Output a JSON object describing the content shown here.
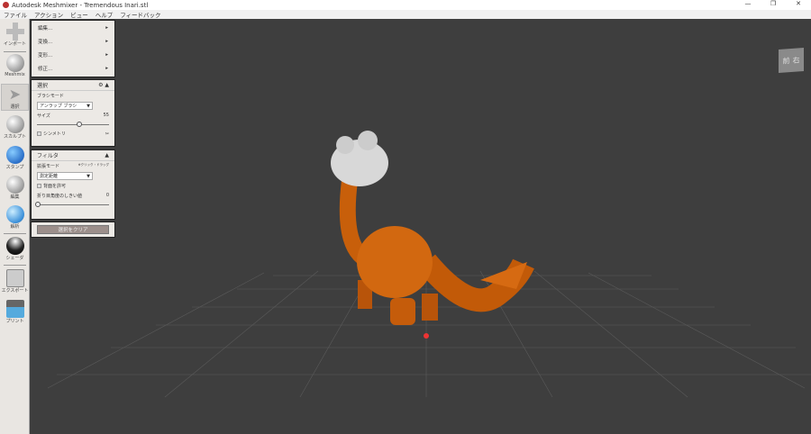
{
  "window": {
    "title": "Autodesk Meshmixer - Tremendous Inari.stl",
    "minimize": "—",
    "restore": "❐",
    "close": "✕"
  },
  "menu": [
    "ファイル",
    "アクション",
    "ビュー",
    "ヘルプ",
    "フィードバック"
  ],
  "tools": [
    {
      "label": "インポート",
      "icon": "plus-icon"
    },
    {
      "label": "Meshmix",
      "icon": "meshmix-icon"
    },
    {
      "label": "選択",
      "icon": "select-arrow-icon"
    },
    {
      "label": "スカルプト",
      "icon": "sculpt-brush-icon"
    },
    {
      "label": "スタンプ",
      "icon": "stamp-icon"
    },
    {
      "label": "編集",
      "icon": "edit-icon"
    },
    {
      "label": "解析",
      "icon": "analysis-icon"
    },
    {
      "label": "シェーダ",
      "icon": "shader-icon"
    },
    {
      "label": "エクスポート",
      "icon": "export-icon"
    },
    {
      "label": "プリント",
      "icon": "print-icon"
    }
  ],
  "edit_menu": [
    "編集...",
    "変換...",
    "変形...",
    "修正..."
  ],
  "select_panel": {
    "title": "選択",
    "brush_mode_label": "ブラシモード",
    "brush_mode_value": "アンラップ ブラシ",
    "size_label": "サイズ",
    "size_value": "55",
    "size_fraction": 0.55,
    "symmetry_label": "シンメトリ"
  },
  "filter_panel": {
    "title": "フィルタ",
    "expand_mode_label": "拡張モード",
    "expand_hint": "※クリック・ドラッグ",
    "expand_mode_value": "測定距離",
    "allow_back_label": "背面を許可",
    "crease_label": "折り目角度のしきい値",
    "crease_value": "0"
  },
  "clear_button": "選択をクリア",
  "viewcube": {
    "front": "前",
    "right": "右"
  }
}
